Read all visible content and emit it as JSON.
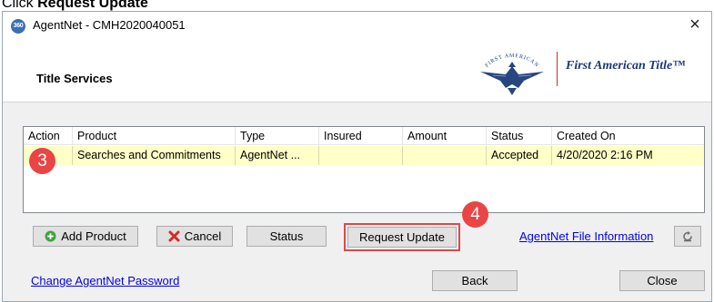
{
  "instruction": {
    "prefix": "Click ",
    "emphasis": "Request Update"
  },
  "window": {
    "app_icon_text": "360",
    "title": "AgentNet - CMH2020040051",
    "close_glyph": "×"
  },
  "header": {
    "section_title": "Title Services",
    "logo_text": "First American Title™",
    "logo_arc_text": "FIRST AMERICAN"
  },
  "grid": {
    "columns": [
      "Action",
      "Product",
      "Type",
      "Insured",
      "Amount",
      "Status",
      "Created On"
    ],
    "rows": [
      {
        "action": "",
        "product": "Searches and Commitments",
        "type": "AgentNet ...",
        "insured": "",
        "amount": "",
        "status": "Accepted",
        "created_on": "4/20/2020 2:16 PM"
      }
    ]
  },
  "buttons": {
    "add_product": "Add Product",
    "cancel": "Cancel",
    "status": "Status",
    "request_update": "Request Update",
    "back": "Back",
    "close": "Close"
  },
  "links": {
    "file_info": "AgentNet File Information",
    "change_password": "Change AgentNet Password"
  },
  "annotations": {
    "step3": "3",
    "step4": "4"
  },
  "colors": {
    "selected_row": "#ffffc8",
    "annotation": "#e94545",
    "link": "#0000ee",
    "logo_blue": "#1c3a78"
  }
}
